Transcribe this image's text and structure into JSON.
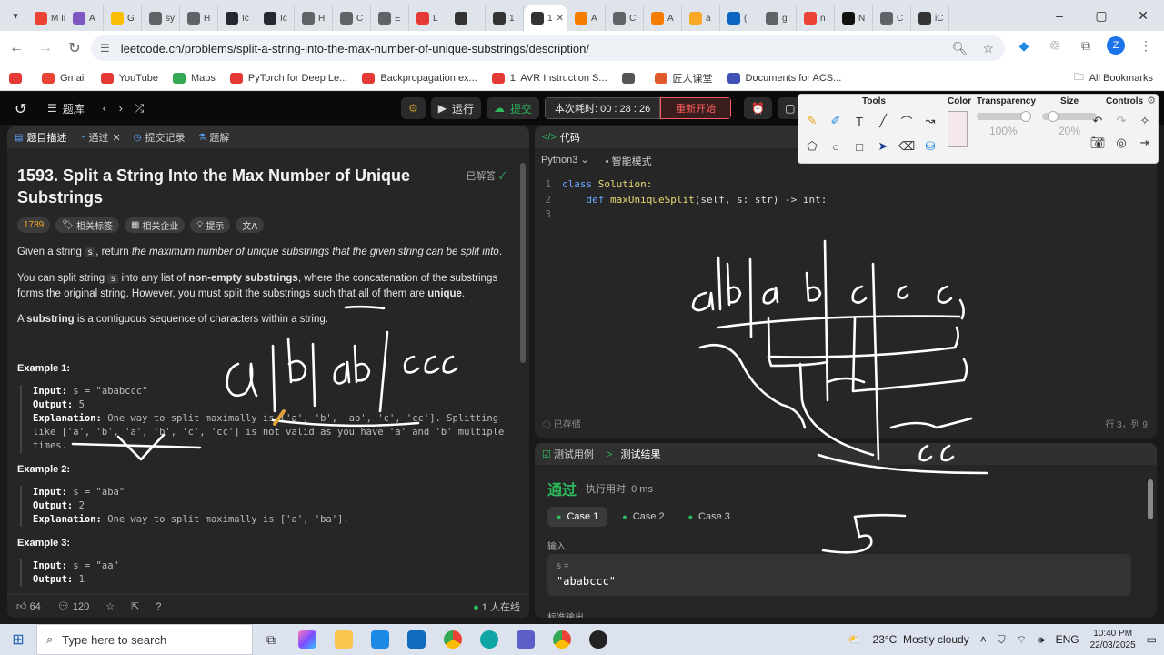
{
  "browser": {
    "tabs": [
      {
        "label": "M Ir",
        "color": "#ea4335"
      },
      {
        "label": "A",
        "color": "#7e57c2"
      },
      {
        "label": "G",
        "color": "#fbbc04"
      },
      {
        "label": "sy",
        "color": "#5f6368"
      },
      {
        "label": "H",
        "color": "#5f6368"
      },
      {
        "label": "Ic",
        "color": "#24292f"
      },
      {
        "label": "Ic",
        "color": "#24292f"
      },
      {
        "label": "H",
        "color": "#5f6368"
      },
      {
        "label": "C",
        "color": "#5f6368"
      },
      {
        "label": "E",
        "color": "#5f6368"
      },
      {
        "label": "L",
        "color": "#e53935"
      },
      {
        "label": "",
        "color": "#333"
      },
      {
        "label": "1",
        "color": "#333"
      },
      {
        "label": "1",
        "color": "#333"
      },
      {
        "label": "A",
        "color": "#f57c00"
      },
      {
        "label": "C",
        "color": "#5f6368"
      },
      {
        "label": "A",
        "color": "#f57c00"
      },
      {
        "label": "a",
        "color": "#f9a825"
      },
      {
        "label": "(",
        "color": "#0a66c2"
      },
      {
        "label": "g",
        "color": "#5f6368"
      },
      {
        "label": "n",
        "color": "#ea4335"
      },
      {
        "label": "N",
        "color": "#111"
      },
      {
        "label": "C",
        "color": "#5f6368"
      },
      {
        "label": "iC",
        "color": "#333"
      }
    ],
    "url": "leetcode.cn/problems/split-a-string-into-the-max-number-of-unique-substrings/description/",
    "profile_initial": "Z",
    "bookmarks": [
      {
        "label": "",
        "color": "#e53935"
      },
      {
        "label": "Gmail",
        "color": "#ea4335"
      },
      {
        "label": "YouTube",
        "color": "#e53935"
      },
      {
        "label": "Maps",
        "color": "#34a853"
      },
      {
        "label": "PyTorch for Deep Le...",
        "color": "#e53935"
      },
      {
        "label": "Backpropagation ex...",
        "color": "#e53935"
      },
      {
        "label": "1. AVR Instruction S...",
        "color": "#e53935"
      },
      {
        "label": "",
        "color": "#555"
      },
      {
        "label": "匠人课堂",
        "color": "#e05a2b"
      },
      {
        "label": "Documents for ACS...",
        "color": "#3f51b5"
      }
    ],
    "all_bookmarks": "All Bookmarks"
  },
  "lc_header": {
    "problem_list": "题库",
    "run": "运行",
    "submit": "提交",
    "timer_label": "本次耗时: 00 : 28 : 26",
    "restart": "重新开始"
  },
  "left": {
    "tabs": [
      "题目描述",
      "通过",
      "提交记录",
      "题解"
    ],
    "title": "1593. Split a String Into the Max Number of Unique Substrings",
    "solved": "已解答",
    "tags": [
      "1739",
      "相关标签",
      "相关企业",
      "提示",
      "文A"
    ],
    "p1_a": "Given a string ",
    "p1_code": "s",
    "p1_b": ", return ",
    "p1_em": "the maximum number of unique substrings that the given string can be split into",
    "p1_c": ".",
    "p2_a": "You can split string ",
    "p2_code": "s",
    "p2_b": " into any list of ",
    "p2_bold1": "non-empty substrings",
    "p2_c": ", where the concatenation of the substrings forms the original string. However, you must split the substrings such that all of them are ",
    "p2_bold2": "unique",
    "p2_d": ".",
    "p3_a": "A ",
    "p3_bold": "substring",
    "p3_b": " is a contiguous sequence of characters within a string.",
    "ex1_title": "Example 1:",
    "ex1_input": "s = \"ababccc\"",
    "ex1_output": "5",
    "ex1_expl": "One way to split maximally is ['a', 'b', 'ab', 'c', 'cc']. Splitting like ['a', 'b', 'a', 'b', 'c', 'cc'] is not valid as you have 'a' and 'b' multiple times.",
    "ex2_title": "Example 2:",
    "ex2_input": "s = \"aba\"",
    "ex2_output": "2",
    "ex2_expl": "One way to split maximally is ['a', 'ba'].",
    "ex3_title": "Example 3:",
    "ex3_input": "s = \"aa\"",
    "ex3_output": "1",
    "input_label": "Input:",
    "output_label": "Output:",
    "expl_label": "Explanation:",
    "likes": "64",
    "comments": "120",
    "online": "1 人在线"
  },
  "editor": {
    "tab": "代码",
    "lang": "Python3",
    "mode": "智能模式",
    "lines": [
      {
        "n": "1",
        "kw": "class ",
        "rest": "Solution:"
      },
      {
        "n": "2",
        "kw": "    def ",
        "fn": "maxUniqueSplit",
        "rest": "(self, s: str) -> int:"
      },
      {
        "n": "3",
        "kw": "",
        "rest": ""
      }
    ],
    "status": "已存储",
    "position": "行 3，列 9"
  },
  "results": {
    "tabs": [
      "测试用例",
      "测试结果"
    ],
    "status": "通过",
    "runtime": "执行用时: 0 ms",
    "cases": [
      "Case 1",
      "Case 2",
      "Case 3"
    ],
    "input_label": "输入",
    "var": "s =",
    "value": "\"ababccc\"",
    "cut": "标准输出"
  },
  "tools_panel": {
    "tools": "Tools",
    "color": "Color",
    "transparency": "Transparency",
    "size": "Size",
    "controls": "Controls",
    "transparency_value": "100%",
    "size_value": "20%"
  },
  "taskbar": {
    "search_placeholder": "Type here to search",
    "weather": "23°C  Mostly cloudy",
    "lang": "ENG",
    "time": "10:40 PM",
    "date": "22/03/2025"
  }
}
